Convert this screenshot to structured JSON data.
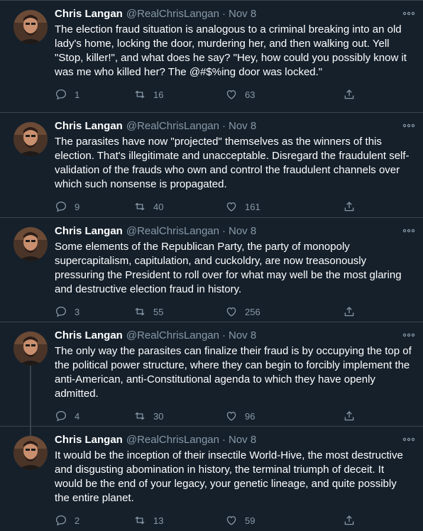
{
  "author": {
    "name": "Chris Langan",
    "handle": "@RealChrisLangan"
  },
  "separator": "·",
  "tweets": [
    {
      "date": "Nov 8",
      "text": "The election fraud situation is analogous to a criminal breaking into an old lady's home, locking the door, murdering her, and then walking out. Yell \"Stop, killer!\", and what does he say? \"Hey, how could you possibly know it was me who killed her? The @#$%ing door was locked.\"",
      "replies": "1",
      "retweets": "16",
      "likes": "63"
    },
    {
      "date": "Nov 8",
      "text": "The parasites have now \"projected\" themselves as the winners of this election. That's illegitimate and unacceptable. Disregard the fraudulent self-validation of the frauds who own and control the fraudulent channels over which such nonsense is propagated.",
      "replies": "9",
      "retweets": "40",
      "likes": "161"
    },
    {
      "date": "Nov 8",
      "text": "Some elements of the Republican Party, the party of monopoly supercapitalism, capitulation, and cuckoldry, are now treasonously pressuring the President to roll over for what may well be the most glaring and destructive election fraud in history.",
      "replies": "3",
      "retweets": "55",
      "likes": "256"
    },
    {
      "date": "Nov 8",
      "text": "The only way the parasites can finalize their fraud is by occupying the top of the political power structure, where they can begin to forcibly implement the anti-American, anti-Constitutional agenda to which they have openly admitted.",
      "replies": "4",
      "retweets": "30",
      "likes": "96"
    },
    {
      "date": "Nov 8",
      "text": "It would be the inception of their insectile World-Hive, the most destructive and disgusting abomination in history, the terminal triumph of deceit. It would be the end of your legacy, your genetic lineage, and quite possibly the entire planet.",
      "replies": "2",
      "retweets": "13",
      "likes": "59"
    }
  ],
  "icons": {
    "reply": "reply-icon",
    "retweet": "retweet-icon",
    "like": "heart-icon",
    "share": "share-icon",
    "more": "more-icon"
  },
  "colors": {
    "background": "#15202b",
    "muted": "#8899a6",
    "border": "#38444d"
  }
}
